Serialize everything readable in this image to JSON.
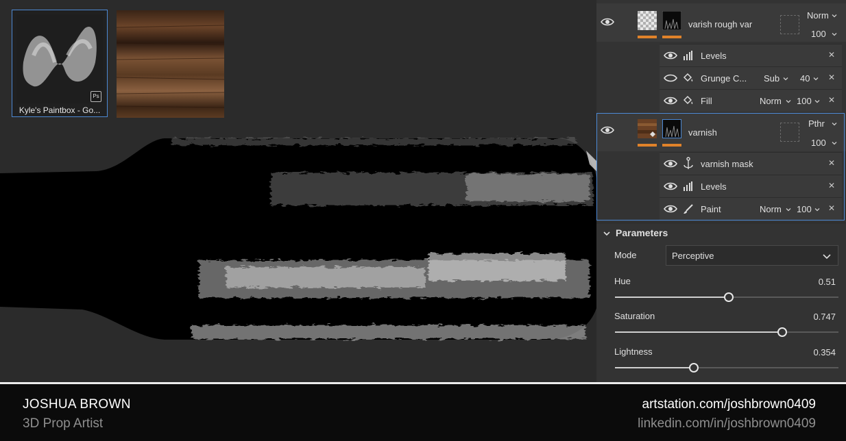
{
  "viewport": {
    "brush_thumbnail": {
      "label": "Kyle's Paintbox - Go...",
      "badge": "Ps"
    }
  },
  "layers": [
    {
      "name": "varish rough var",
      "blend": "Norm",
      "opacity": "100",
      "children": [
        {
          "name": "Levels",
          "icon": "levels-icon"
        },
        {
          "name": "Grunge C...",
          "icon": "fill-bucket-icon",
          "blend": "Sub",
          "opacity": "40",
          "hidden": true
        },
        {
          "name": "Fill",
          "icon": "fill-bucket-icon",
          "blend": "Norm",
          "opacity": "100"
        }
      ]
    },
    {
      "name": "varnish",
      "blend": "Pthr",
      "opacity": "100",
      "children": [
        {
          "name": "varnish mask",
          "icon": "anchor-icon"
        },
        {
          "name": "Levels",
          "icon": "levels-icon"
        },
        {
          "name": "Paint",
          "icon": "brush-icon",
          "blend": "Norm",
          "opacity": "100"
        }
      ]
    }
  ],
  "parameters": {
    "title": "Parameters",
    "mode_label": "Mode",
    "mode_value": "Perceptive",
    "sliders": [
      {
        "label": "Hue",
        "value": "0.51",
        "level": 0.51
      },
      {
        "label": "Saturation",
        "value": "0.747",
        "level": 0.747
      },
      {
        "label": "Lightness",
        "value": "0.354",
        "level": 0.354
      }
    ]
  },
  "footer": {
    "name": "JOSHUA BROWN",
    "role": "3D Prop Artist",
    "site": "artstation.com/joshbrown0409",
    "linkedin": "linkedin.com/in/joshbrown0409"
  },
  "colors": {
    "accent_blue": "#4d8ad6",
    "accent_orange": "#e0822a",
    "panel_bg": "#3a3a3a"
  }
}
